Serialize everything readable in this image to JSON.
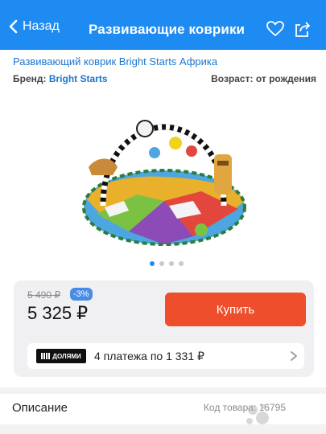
{
  "header": {
    "back_label": "Назад",
    "title": "Развивающие коврики",
    "icons": [
      "chevron-left-icon",
      "heart-icon",
      "share-icon"
    ],
    "background_color": "#1d8bf1"
  },
  "product": {
    "title": "Развивающий коврик Bright Starts Африка",
    "brand_label": "Бренд:",
    "brand_value": "Bright Starts",
    "age_label": "Возраст:",
    "age_value": "от рождения"
  },
  "gallery": {
    "slides": 4,
    "active_slide": 1
  },
  "price_card": {
    "old_price": "5 490 ₽",
    "discount": "-3%",
    "price": "5 325 ₽",
    "buy_label": "Купить",
    "buy_color": "#ee4e2b",
    "dolyami_logo": "ДОЛЯМИ",
    "installment_text": "4 платежа по 1 331 ₽"
  },
  "description": {
    "title": "Описание",
    "sku": "Код товара: 16795"
  }
}
